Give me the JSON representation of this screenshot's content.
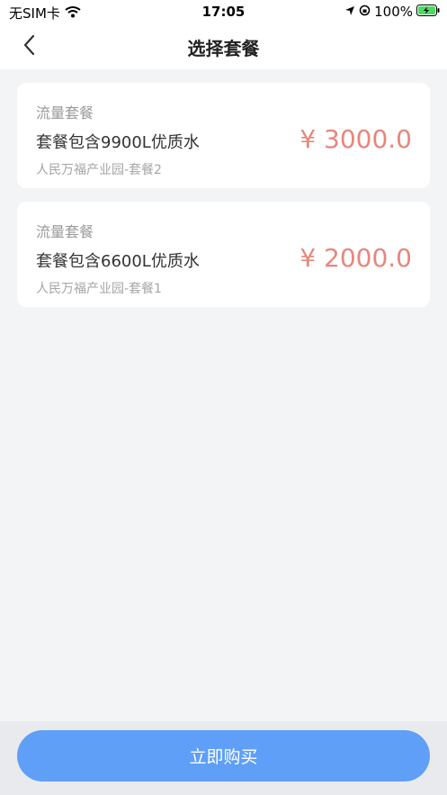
{
  "status_bar": {
    "carrier": "无SIM卡",
    "time": "17:05",
    "battery": "100%"
  },
  "nav": {
    "title": "选择套餐"
  },
  "packages": [
    {
      "type": "流量套餐",
      "description": "套餐包含9900L优质水",
      "subtitle": "人民万福产业园-套餐2",
      "price": "¥ 3000.0"
    },
    {
      "type": "流量套餐",
      "description": "套餐包含6600L优质水",
      "subtitle": "人民万福产业园-套餐1",
      "price": "¥ 2000.0"
    }
  ],
  "footer": {
    "buy_label": "立即购买"
  },
  "colors": {
    "price": "#e6877c",
    "button": "#5f9ff7",
    "background": "#f3f4f5"
  }
}
